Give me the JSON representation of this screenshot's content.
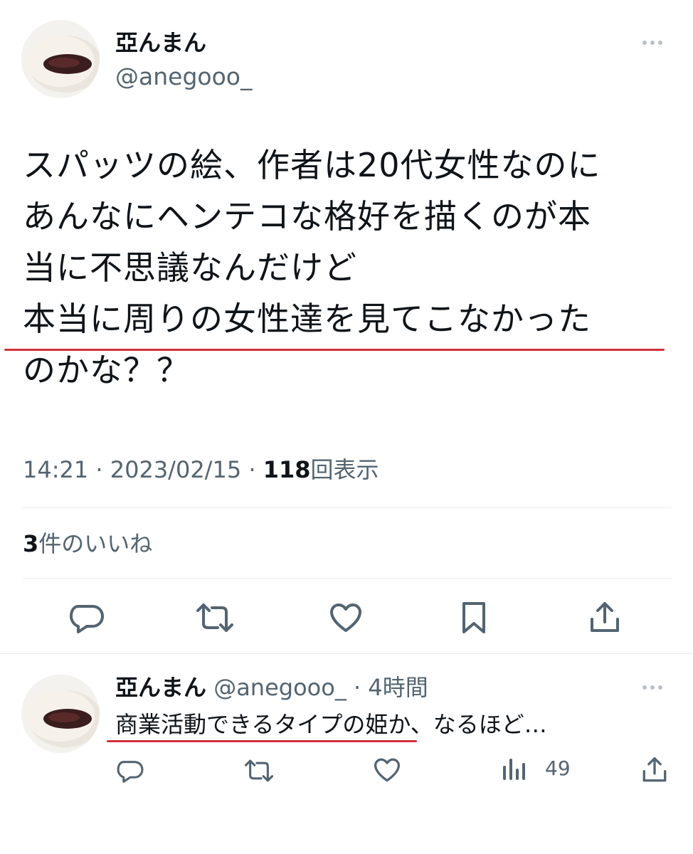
{
  "main_tweet": {
    "display_name": "亞んまん",
    "handle": "@anegooo_",
    "text_lines": [
      "スパッツの絵、作者は20代女性なのに",
      "あんなにヘンテコな格好を描くのが本",
      "当に不思議なんだけど",
      "本当に周りの女性達を見てこなかった",
      "のかな？？"
    ],
    "time": "14:21",
    "date": "2023/02/15",
    "separator": "·",
    "views_count": "118",
    "views_label": "回表示",
    "likes_count": "3",
    "likes_label": "件のいいね",
    "actions": [
      "reply-icon",
      "retweet-icon",
      "like-icon",
      "bookmark-icon",
      "share-icon"
    ]
  },
  "reply_tweet": {
    "display_name": "亞んまん",
    "handle": "@anegooo_",
    "separator": "·",
    "time_ago": "4時間",
    "text": "商業活動できるタイプの姫か、なるほど…",
    "views_count": "49",
    "actions": [
      "reply-icon",
      "retweet-icon",
      "like-icon",
      "views-icon",
      "share-icon"
    ]
  },
  "colors": {
    "text_primary": "#0f1419",
    "text_secondary": "#536471",
    "underline_red": "#d2303c",
    "divider": "#e6e9ec"
  }
}
